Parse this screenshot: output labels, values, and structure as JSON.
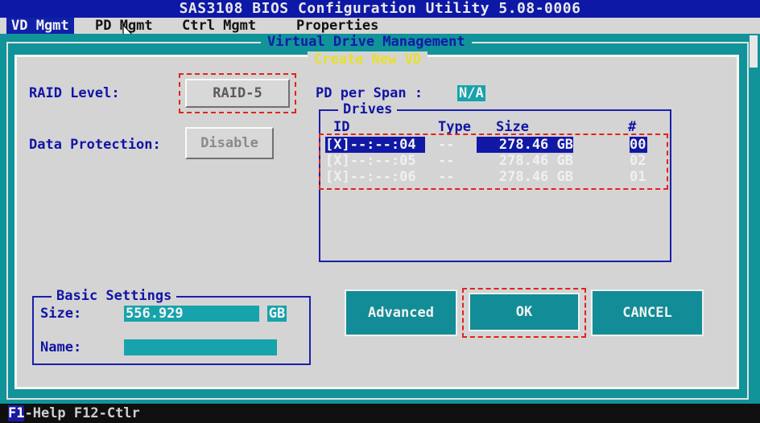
{
  "window_title": "SAS3108 BIOS Configuration Utility 5.08-0006",
  "menu": [
    {
      "label": "VD Mgmt",
      "active": true
    },
    {
      "label": "PD Mgmt",
      "active": false
    },
    {
      "label": "Ctrl Mgmt",
      "active": false
    },
    {
      "label": "Properties",
      "active": false
    }
  ],
  "outer_panel_title": "Virtual Drive Management",
  "dialog": {
    "title": "Create New VD",
    "raid_level_label": "RAID Level:",
    "raid_level_value": "RAID-5",
    "data_protection_label": "Data Protection:",
    "data_protection_value": "Disable",
    "pd_per_span_label": "PD per Span :",
    "pd_per_span_value": "N/A",
    "drives": {
      "title": "Drives",
      "columns": [
        "ID",
        "Type",
        "Size",
        "#"
      ],
      "rows": [
        {
          "id": "[X]--:--:04",
          "type": "--",
          "size": "278.46 GB",
          "num": "00",
          "highlighted": true
        },
        {
          "id": "[X]--:--:05",
          "type": "--",
          "size": "278.46 GB",
          "num": "02",
          "highlighted": false
        },
        {
          "id": "[X]--:--:06",
          "type": "--",
          "size": "278.46 GB",
          "num": "01",
          "highlighted": false
        }
      ]
    },
    "basic_settings": {
      "title": "Basic Settings",
      "size_label": "Size:",
      "size_value": "556.929",
      "size_unit": "GB",
      "name_label": "Name:",
      "name_value": ""
    },
    "buttons": {
      "advanced": "Advanced",
      "ok": "OK",
      "cancel": "CANCEL"
    }
  },
  "footer": {
    "f1_key": "F1",
    "text": "-Help F12-Ctlr"
  },
  "colors": {
    "title_bar": "#0d18a6",
    "background_teal": "#11939a",
    "dialog_gray": "#d4d4d4",
    "label_blue": "#1114a5",
    "dialog_title_yellow": "#eadf2a",
    "annotation_red": "#e2231a"
  }
}
